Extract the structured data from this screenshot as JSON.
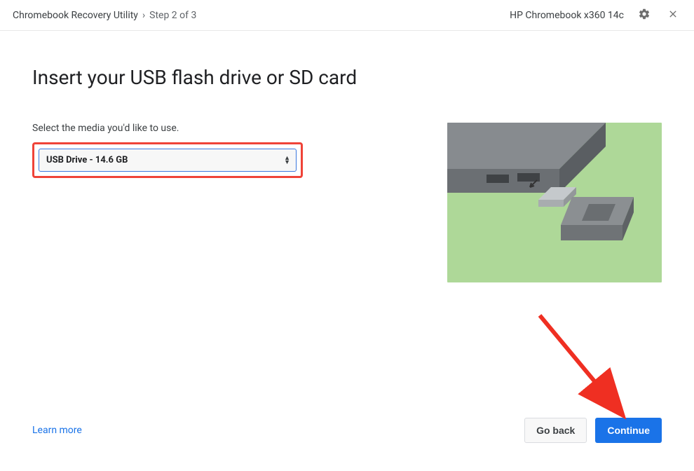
{
  "header": {
    "app_title": "Chromebook Recovery Utility",
    "separator": "›",
    "step_label": "Step 2 of 3",
    "device_label": "HP Chromebook x360 14c"
  },
  "main": {
    "page_title": "Insert your USB flash drive or SD card",
    "instruction": "Select the media you'd like to use.",
    "select_value": "USB Drive - 14.6 GB"
  },
  "footer": {
    "learn_more": "Learn more",
    "back_label": "Go back",
    "continue_label": "Continue"
  }
}
